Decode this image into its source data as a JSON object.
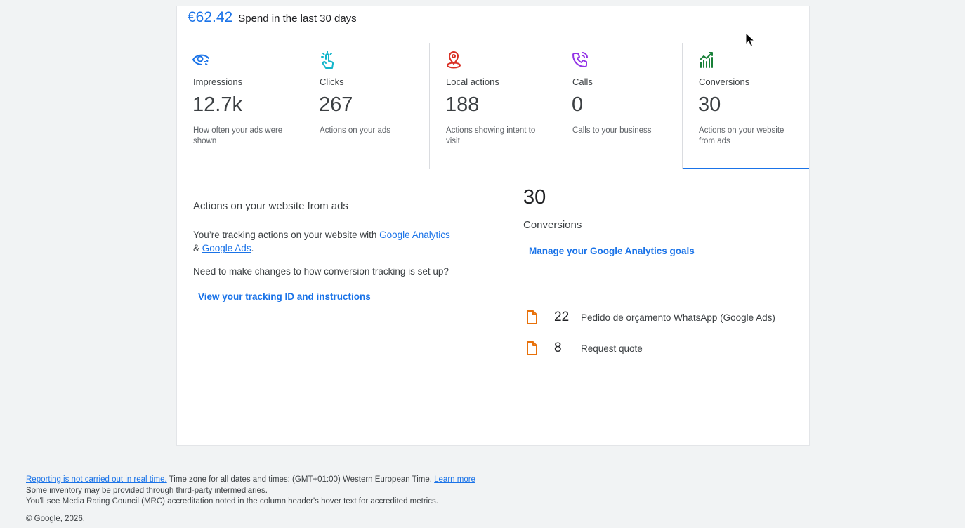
{
  "spend": {
    "amount": "€62.42",
    "label": "Spend in the last 30 days"
  },
  "metrics": [
    {
      "label": "Impressions",
      "value": "12.7k",
      "desc": "How often your ads were shown",
      "icon": "eye-icon",
      "color": "#1a73e8"
    },
    {
      "label": "Clicks",
      "value": "267",
      "desc": "Actions on your ads",
      "icon": "tap-icon",
      "color": "#12b5cb"
    },
    {
      "label": "Local actions",
      "value": "188",
      "desc": "Actions showing intent to visit",
      "icon": "location-pin-icon",
      "color": "#d93025"
    },
    {
      "label": "Calls",
      "value": "0",
      "desc": "Calls to your business",
      "icon": "phone-icon",
      "color": "#9334e6"
    },
    {
      "label": "Conversions",
      "value": "30",
      "desc": "Actions on your website from ads",
      "icon": "trending-chart-icon",
      "color": "#188038"
    }
  ],
  "active_metric": "Conversions",
  "detail": {
    "title": "Actions on your website from ads",
    "text_prefix": "You’re tracking actions on your website with ",
    "link_analytics": "Google Analytics",
    "text_and": "& ",
    "link_ads": "Google Ads",
    "text_end": ".",
    "question": "Need to make changes to how conversion tracking is set up?",
    "tracking_link": "View your tracking ID and instructions"
  },
  "summary": {
    "value": "30",
    "label": "Conversions",
    "manage_link": "Manage your Google Analytics goals",
    "items": [
      {
        "count": "22",
        "name": "Pedido de orçamento WhatsApp (Google Ads)"
      },
      {
        "count": "8",
        "name": "Request quote"
      }
    ]
  },
  "footer": {
    "realtime_link": "Reporting is not carried out in real time.",
    "timezone": " Time zone for all dates and times: (GMT+01:00) Western European Time. ",
    "learn_more": "Learn more",
    "line2": "Some inventory may be provided through third-party intermediaries.",
    "line3": "You'll see Media Rating Council (MRC) accreditation noted in the column header's hover text for accredited metrics.",
    "copyright": "© Google, 2026."
  },
  "colors": {
    "accent": "#1a73e8",
    "conversion_icon": "#e8710a"
  }
}
